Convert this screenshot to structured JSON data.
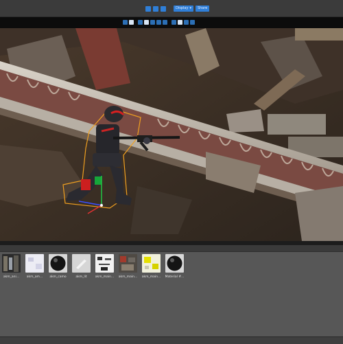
{
  "toolbar": {
    "display_label": "Display",
    "share_label": "Share"
  },
  "viewport": {
    "scene": "game character holding rifle beside stone railing"
  },
  "assets": [
    {
      "label": "akm_ani...",
      "icon": "texture-thumbnail"
    },
    {
      "label": "akm_am...",
      "icon": "texture-thumbnail"
    },
    {
      "label": "akm_camo",
      "icon": "material-sphere"
    },
    {
      "label": "akm_lit",
      "icon": "texture-thumbnail"
    },
    {
      "label": "akm_main...",
      "icon": "texture-thumbnail"
    },
    {
      "label": "akm_main...",
      "icon": "texture-thumbnail"
    },
    {
      "label": "akm_main...",
      "icon": "texture-thumbnail"
    },
    {
      "label": "Material #...",
      "icon": "material-sphere"
    }
  ],
  "colors": {
    "accent": "#2f7fd8",
    "panel": "#575757",
    "topbar": "#3b3b3b",
    "outline": "#f0a020"
  }
}
